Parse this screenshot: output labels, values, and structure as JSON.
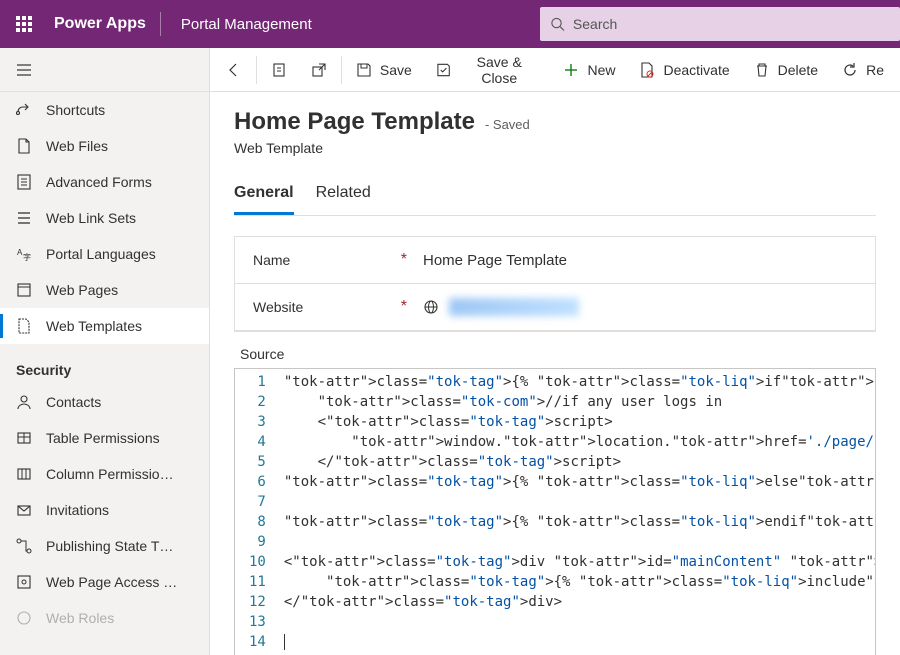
{
  "topbar": {
    "brand": "Power Apps",
    "module": "Portal Management",
    "search_placeholder": "Search"
  },
  "sidebar": {
    "items": [
      {
        "id": "shortcuts",
        "label": "Shortcuts"
      },
      {
        "id": "web-files",
        "label": "Web Files"
      },
      {
        "id": "advanced-forms",
        "label": "Advanced Forms"
      },
      {
        "id": "web-link-sets",
        "label": "Web Link Sets"
      },
      {
        "id": "portal-languages",
        "label": "Portal Languages"
      },
      {
        "id": "web-pages",
        "label": "Web Pages"
      },
      {
        "id": "web-templates",
        "label": "Web Templates",
        "active": true
      }
    ],
    "section_label": "Security",
    "security_items": [
      {
        "id": "contacts",
        "label": "Contacts"
      },
      {
        "id": "table-permissions",
        "label": "Table Permissions"
      },
      {
        "id": "column-permissions",
        "label": "Column Permissio…"
      },
      {
        "id": "invitations",
        "label": "Invitations"
      },
      {
        "id": "publishing-state",
        "label": "Publishing State T…"
      },
      {
        "id": "web-page-access",
        "label": "Web Page Access …"
      },
      {
        "id": "web-roles",
        "label": "Web Roles"
      }
    ]
  },
  "cmdbar": {
    "save": "Save",
    "save_close": "Save & Close",
    "new": "New",
    "deactivate": "Deactivate",
    "delete": "Delete",
    "refresh": "Re"
  },
  "page": {
    "title": "Home Page Template",
    "status": "- Saved",
    "entity": "Web Template",
    "tabs": {
      "general": "General",
      "related": "Related"
    },
    "fields": {
      "name_label": "Name",
      "name_value": "Home Page Template",
      "website_label": "Website"
    },
    "source_label": "Source",
    "code_lines": [
      "{% if user %}",
      "    //if any user logs in",
      "    <script>",
      "        window.location.href='./page/'",
      "    </script>",
      "{% else %}",
      "",
      "{% endif %}",
      "",
      "<div id=\"mainContent\" class = \"wrapper-body\" role=\"main\">",
      "     {% include 'Page Copy' %}",
      "</div>",
      "",
      ""
    ]
  }
}
